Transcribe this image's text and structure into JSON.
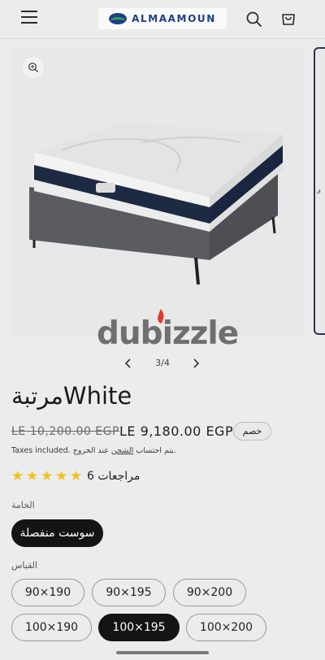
{
  "header": {
    "brand": "ALMAAMOUN",
    "icons": [
      "menu-icon",
      "search-icon",
      "cart-icon"
    ]
  },
  "gallery": {
    "counter": "3/4",
    "watermark": "dubizzle",
    "next_thumb_text": "ق"
  },
  "product": {
    "title": "مرتبةWhite",
    "price_old": "LE 10,200.00 EGP",
    "price_new": "LE 9,180.00 EGP",
    "sale_badge": "خصم",
    "tax_prefix": "Taxes included.",
    "tax_arabic_1": "يتم احتساب",
    "tax_link": "الشحن",
    "tax_arabic_2": "عند الخروج.",
    "rating": 5,
    "reviews": "مراجعات 6"
  },
  "material": {
    "label": "الخامة",
    "options": [
      "سوست منفصلة"
    ],
    "selected": "سوست منفصلة"
  },
  "size": {
    "label": "القياس",
    "options": [
      "90×190",
      "90×195",
      "90×200",
      "100×190",
      "100×195",
      "100×200"
    ],
    "selected": "100×195"
  },
  "colors": {
    "accent": "#141414",
    "star": "#f2c21a",
    "brand": "#1f3d8a"
  }
}
